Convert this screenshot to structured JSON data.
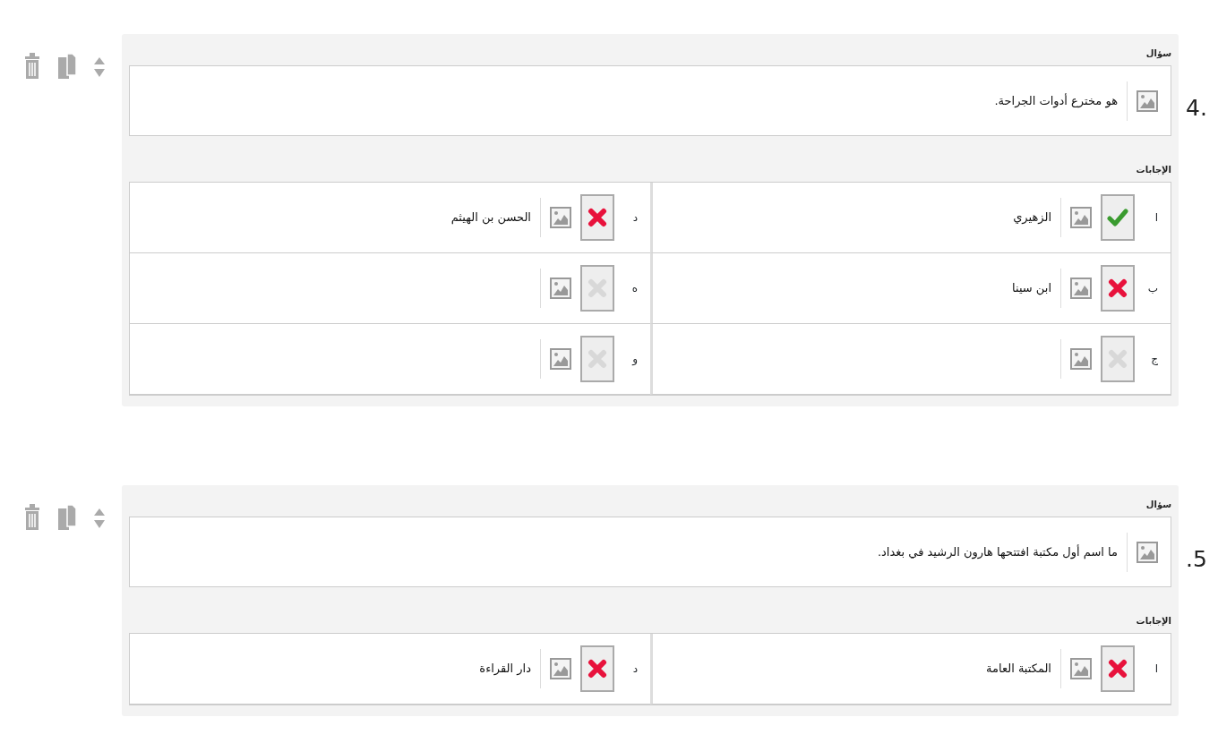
{
  "questions": [
    {
      "number": "4.",
      "question_label": "سؤال",
      "text": "هو مخترع أدوات الجراحة.",
      "answers_label": "الإجابات",
      "answers": [
        {
          "letter": "ا",
          "selected": true,
          "correct": true,
          "text": "الزهيري"
        },
        {
          "letter": "د",
          "selected": true,
          "correct": false,
          "text": "الحسن بن الهيثم"
        },
        {
          "letter": "ب",
          "selected": true,
          "correct": false,
          "text": "ابن سينا"
        },
        {
          "letter": "ه",
          "selected": false
        },
        {
          "letter": "ج",
          "selected": false
        },
        {
          "letter": "و",
          "selected": false
        }
      ]
    },
    {
      "number": ".5",
      "question_label": "سؤال",
      "text": "ما اسم أول مكتبة افتتحها هارون الرشيد في بغداد.",
      "answers_label": "الإجابات",
      "answers": [
        {
          "letter": "ا",
          "selected": true,
          "correct": false,
          "text": "المكتبة العامة"
        },
        {
          "letter": "د",
          "selected": true,
          "correct": false,
          "text": "دار القراءة"
        }
      ]
    }
  ]
}
